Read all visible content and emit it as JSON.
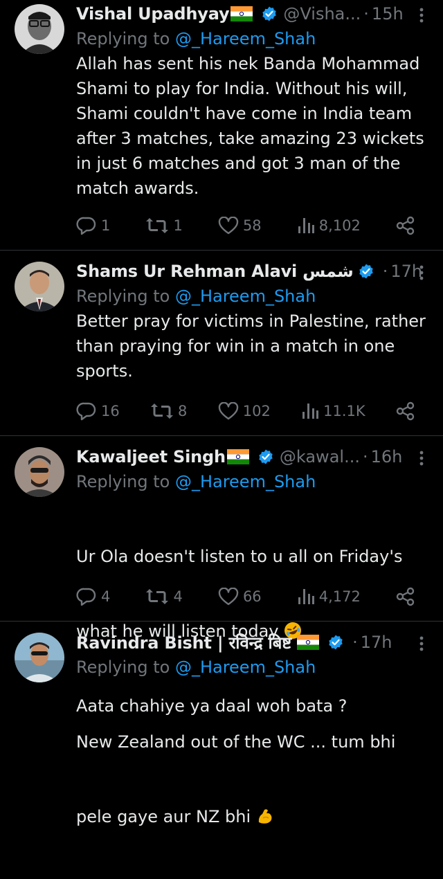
{
  "replies": [
    {
      "name": "Vishal Upadhyay",
      "flag": "india-flag",
      "handle": "@Visha...",
      "dot": "·",
      "time": "15h",
      "replying_prefix": "Replying to ",
      "replying_to": "@_Hareem_Shah",
      "text": "Allah has sent his nek Banda Mohammad\nShami to play for India. Without his will,\nShami couldn't have come in India team\nafter 3 matches, take amazing 23 wickets\nin just 6 matches and got 3 man of the\nmatch awards.",
      "replies_count": "1",
      "reposts_count": "1",
      "likes_count": "58",
      "views_count": "8,102"
    },
    {
      "name": "Shams Ur Rehman Alavi",
      "name_extra": "شمس",
      "handle": "",
      "dot": "·",
      "time": "17h",
      "replying_prefix": "Replying to ",
      "replying_to": "@_Hareem_Shah",
      "text": "Better pray for victims in Palestine, rather\nthan praying for win in a match in one\nsports.",
      "replies_count": "16",
      "reposts_count": "8",
      "likes_count": "102",
      "views_count": "11.1K"
    },
    {
      "name": "Kawaljeet Singh",
      "flag": "india-flag",
      "handle": "@kawal...",
      "dot": "·",
      "time": "16h",
      "replying_prefix": "Replying to ",
      "replying_to": "@_Hareem_Shah",
      "text_line1": "Ur Ola doesn't listen to u all on Friday's",
      "text_line2": "what he will listen today",
      "text_emoji": "rofl-emoji",
      "text_line3": "Aata chahiye ya daal woh bata ?",
      "replies_count": "4",
      "reposts_count": "4",
      "likes_count": "66",
      "views_count": "4,172"
    },
    {
      "name": "Ravindra Bisht | रविन्द्र बिष्ट",
      "flag": "india-flag",
      "handle": "",
      "dot": "·",
      "time": "17h",
      "replying_prefix": "Replying to ",
      "replying_to": "@_Hareem_Shah",
      "text_line1": "New Zealand out of the WC ... tum bhi",
      "text_line2": "pele gaye aur NZ bhi",
      "text_emoji": "flexed-biceps-emoji"
    }
  ],
  "colors": {
    "background": "#000000",
    "text": "#e7e9ea",
    "muted": "#71767b",
    "link": "#1d9bf0",
    "divider": "#2f3336",
    "verified": "#1d9bf0"
  }
}
